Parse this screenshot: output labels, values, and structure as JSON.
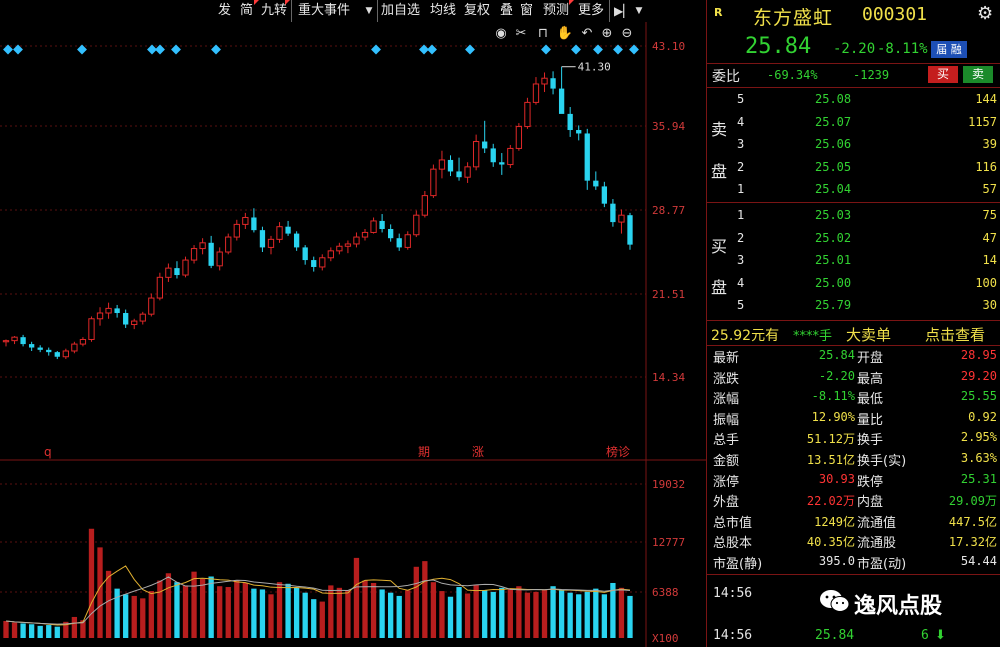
{
  "toolbar": {
    "items": [
      "发",
      "简",
      "九转",
      "重大事件",
      "加自选",
      "均线",
      "复权",
      "叠",
      "窗",
      "预测",
      "更多"
    ],
    "arrow_icon": "play-arrow-icon",
    "more_dropdown_icon": "chevron-down-icon"
  },
  "chart_tools": [
    "eye-icon",
    "scissors-icon",
    "lock-icon",
    "hand-icon",
    "undo-icon",
    "zoom-in-icon",
    "zoom-out-icon"
  ],
  "chart_data": {
    "type": "candlestick",
    "price_axis_labels": [
      "43.10",
      "35.94",
      "28.77",
      "21.51",
      "14.34"
    ],
    "price_axis_values": [
      43.1,
      35.94,
      28.77,
      21.51,
      14.34
    ],
    "volume_axis_labels": [
      "19032",
      "12777",
      "6388",
      "X100"
    ],
    "max_annotation": "41.30",
    "max_value": 41.3,
    "event_labels": [
      "q",
      "期",
      "涨",
      "榜诊"
    ],
    "up_color": "#e02828",
    "down_color": "#2ad4f0",
    "ma_color": "#e0b030",
    "ma2_color": "#aaaaaa",
    "candles": [
      [
        17.4,
        17.6,
        17.0,
        17.5
      ],
      [
        17.5,
        17.9,
        17.2,
        17.8
      ],
      [
        17.8,
        18.0,
        17.0,
        17.2
      ],
      [
        17.2,
        17.4,
        16.6,
        16.9
      ],
      [
        16.9,
        17.1,
        16.5,
        16.7
      ],
      [
        16.7,
        16.9,
        16.2,
        16.5
      ],
      [
        16.5,
        16.6,
        15.9,
        16.1
      ],
      [
        16.1,
        16.8,
        15.9,
        16.6
      ],
      [
        16.6,
        17.4,
        16.4,
        17.2
      ],
      [
        17.2,
        17.8,
        17.0,
        17.6
      ],
      [
        17.6,
        19.6,
        17.4,
        19.4
      ],
      [
        19.4,
        20.4,
        18.8,
        19.9
      ],
      [
        19.9,
        20.8,
        19.4,
        20.3
      ],
      [
        20.3,
        20.6,
        19.5,
        19.9
      ],
      [
        19.9,
        20.2,
        18.6,
        18.9
      ],
      [
        18.9,
        19.4,
        18.5,
        19.2
      ],
      [
        19.2,
        20.0,
        18.9,
        19.8
      ],
      [
        19.8,
        21.6,
        19.6,
        21.2
      ],
      [
        21.2,
        23.4,
        21.0,
        23.0
      ],
      [
        23.0,
        24.2,
        22.6,
        23.8
      ],
      [
        23.8,
        24.4,
        22.9,
        23.2
      ],
      [
        23.2,
        24.8,
        23.0,
        24.5
      ],
      [
        24.5,
        25.8,
        24.2,
        25.5
      ],
      [
        25.5,
        26.4,
        25.0,
        26.0
      ],
      [
        26.0,
        26.6,
        23.8,
        24.0
      ],
      [
        24.0,
        25.6,
        23.6,
        25.2
      ],
      [
        25.2,
        26.8,
        25.0,
        26.5
      ],
      [
        26.5,
        28.0,
        26.2,
        27.6
      ],
      [
        27.6,
        28.6,
        27.2,
        28.2
      ],
      [
        28.2,
        29.0,
        26.9,
        27.1
      ],
      [
        27.1,
        27.4,
        25.2,
        25.6
      ],
      [
        25.6,
        26.6,
        25.0,
        26.3
      ],
      [
        26.3,
        27.8,
        26.0,
        27.4
      ],
      [
        27.4,
        27.9,
        26.6,
        26.8
      ],
      [
        26.8,
        27.0,
        25.3,
        25.6
      ],
      [
        25.6,
        25.8,
        24.1,
        24.5
      ],
      [
        24.5,
        24.8,
        23.5,
        23.9
      ],
      [
        23.9,
        25.0,
        23.6,
        24.7
      ],
      [
        24.7,
        25.6,
        24.4,
        25.3
      ],
      [
        25.3,
        26.0,
        25.0,
        25.7
      ],
      [
        25.7,
        26.2,
        25.1,
        25.9
      ],
      [
        25.9,
        26.9,
        25.6,
        26.5
      ],
      [
        26.5,
        27.2,
        26.2,
        26.9
      ],
      [
        26.9,
        28.2,
        26.8,
        27.9
      ],
      [
        27.9,
        28.5,
        26.9,
        27.2
      ],
      [
        27.2,
        27.6,
        26.1,
        26.4
      ],
      [
        26.4,
        26.8,
        25.3,
        25.6
      ],
      [
        25.6,
        27.0,
        25.4,
        26.7
      ],
      [
        26.7,
        28.8,
        26.5,
        28.4
      ],
      [
        28.4,
        30.5,
        28.2,
        30.1
      ],
      [
        30.1,
        32.8,
        29.9,
        32.4
      ],
      [
        32.4,
        34.0,
        31.6,
        33.2
      ],
      [
        33.2,
        33.6,
        31.8,
        32.2
      ],
      [
        32.2,
        33.4,
        31.4,
        31.7
      ],
      [
        31.7,
        33.0,
        31.2,
        32.6
      ],
      [
        32.6,
        35.4,
        32.3,
        34.8
      ],
      [
        34.8,
        36.6,
        33.8,
        34.2
      ],
      [
        34.2,
        34.6,
        32.6,
        33.0
      ],
      [
        33.0,
        33.8,
        31.9,
        32.8
      ],
      [
        32.8,
        34.5,
        32.5,
        34.2
      ],
      [
        34.2,
        36.4,
        34.0,
        36.1
      ],
      [
        36.1,
        38.6,
        35.9,
        38.2
      ],
      [
        38.2,
        40.4,
        38.0,
        39.8
      ],
      [
        39.8,
        40.8,
        39.1,
        40.3
      ],
      [
        40.3,
        40.9,
        38.9,
        39.4
      ],
      [
        39.4,
        41.3,
        38.7,
        37.2
      ],
      [
        37.2,
        37.8,
        35.2,
        35.8
      ],
      [
        35.8,
        36.2,
        34.9,
        35.5
      ],
      [
        35.5,
        35.9,
        30.6,
        31.4
      ],
      [
        31.4,
        32.2,
        30.6,
        30.9
      ],
      [
        30.9,
        31.3,
        29.1,
        29.4
      ],
      [
        29.4,
        29.8,
        27.4,
        27.8
      ],
      [
        27.8,
        28.9,
        26.8,
        28.4
      ],
      [
        28.4,
        28.6,
        25.4,
        25.84
      ]
    ],
    "volumes": [
      2100,
      1900,
      1800,
      1700,
      1500,
      1600,
      1400,
      2000,
      2600,
      2200,
      13500,
      11200,
      8300,
      6100,
      5400,
      5200,
      4900,
      5800,
      7100,
      8000,
      6900,
      6500,
      8200,
      7300,
      7600,
      6400,
      6300,
      7100,
      6800,
      6100,
      6000,
      5400,
      6900,
      6700,
      6200,
      5600,
      4800,
      4500,
      6500,
      6200,
      5900,
      9900,
      7100,
      6800,
      6000,
      5600,
      5200,
      5900,
      8800,
      9500,
      6900,
      5800,
      5100,
      6300,
      5500,
      6600,
      5900,
      5700,
      6200,
      6100,
      6400,
      5600,
      5700,
      6000,
      6400,
      5900,
      5600,
      5400,
      5700,
      6100,
      5400,
      6800,
      6200,
      5200
    ],
    "vol_max": 19032
  },
  "stock": {
    "badge": "R",
    "name": "东方盛虹",
    "code": "000301",
    "settings_icon": "gear-icon",
    "price": "25.84",
    "change": "-2.20",
    "change_pct": "-8.11%",
    "connect_badge": "届 融",
    "ratio_label": "委比",
    "ratio_pct": "-69.34%",
    "ratio_diff": "-1239",
    "sell_button": "买",
    "buy_button": "卖"
  },
  "order_book": {
    "sell_label_1": "卖",
    "sell_label_2": "盘",
    "buy_label_1": "买",
    "buy_label_2": "盘",
    "asks": [
      {
        "level": "5",
        "price": "25.08",
        "volume": "144"
      },
      {
        "level": "4",
        "price": "25.07",
        "volume": "1157"
      },
      {
        "level": "3",
        "price": "25.06",
        "volume": "39"
      },
      {
        "level": "2",
        "price": "25.05",
        "volume": "116"
      },
      {
        "level": "1",
        "price": "25.04",
        "volume": "57"
      }
    ],
    "bids": [
      {
        "level": "1",
        "price": "25.03",
        "volume": "75"
      },
      {
        "level": "2",
        "price": "25.02",
        "volume": "47"
      },
      {
        "level": "3",
        "price": "25.01",
        "volume": "14"
      },
      {
        "level": "4",
        "price": "25.00",
        "volume": "100"
      },
      {
        "level": "5",
        "price": "25.79",
        "volume": "30"
      }
    ]
  },
  "big_order": {
    "price_text": "25.92元有",
    "qty_text": "****手",
    "label": "大卖单",
    "link": "点击查看"
  },
  "stats": [
    {
      "l1": "最新",
      "v1": "25.84",
      "c1": "green",
      "l2": "开盘",
      "v2": "28.95",
      "c2": "red"
    },
    {
      "l1": "涨跌",
      "v1": "-2.20",
      "c1": "green",
      "l2": "最高",
      "v2": "29.20",
      "c2": "red"
    },
    {
      "l1": "涨幅",
      "v1": "-8.11%",
      "c1": "green",
      "l2": "最低",
      "v2": "25.55",
      "c2": "green"
    },
    {
      "l1": "振幅",
      "v1": "12.90%",
      "c1": "yellow",
      "l2": "量比",
      "v2": "0.92",
      "c2": "yellow"
    },
    {
      "l1": "总手",
      "v1": "51.12万",
      "c1": "yellow",
      "l2": "换手",
      "v2": "2.95%",
      "c2": "yellow"
    },
    {
      "l1": "金额",
      "v1": "13.51亿",
      "c1": "yellow",
      "l2": "换手(实)",
      "v2": "3.63%",
      "c2": "yellow"
    },
    {
      "l1": "涨停",
      "v1": "30.93",
      "c1": "red",
      "l2": "跌停",
      "v2": "25.31",
      "c2": "green"
    },
    {
      "l1": "外盘",
      "v1": "22.02万",
      "c1": "red",
      "l2": "内盘",
      "v2": "29.09万",
      "c2": "green"
    },
    {
      "l1": "总市值",
      "v1": "1249亿",
      "c1": "yellow",
      "l2": "流通值",
      "v2": "447.5亿",
      "c2": "yellow"
    },
    {
      "l1": "总股本",
      "v1": "40.35亿",
      "c1": "yellow",
      "l2": "流通股",
      "v2": "17.32亿",
      "c2": "yellow"
    },
    {
      "l1": "市盈(静)",
      "v1": "395.0",
      "c1": "white",
      "l2": "市盈(动)",
      "v2": "54.44",
      "c2": "white"
    }
  ],
  "ticks": [
    {
      "time": "14:56",
      "price": "",
      "volume": ""
    },
    {
      "time": "14:56",
      "price": "25.84",
      "volume": "6"
    }
  ],
  "watermark": {
    "icon": "wechat-icon",
    "text": "逸风点股"
  },
  "colors": {
    "up": "#ff3434",
    "down": "#32d232",
    "yellow": "#f0e04a",
    "border": "#7a1414",
    "cyan": "#33ccee"
  }
}
